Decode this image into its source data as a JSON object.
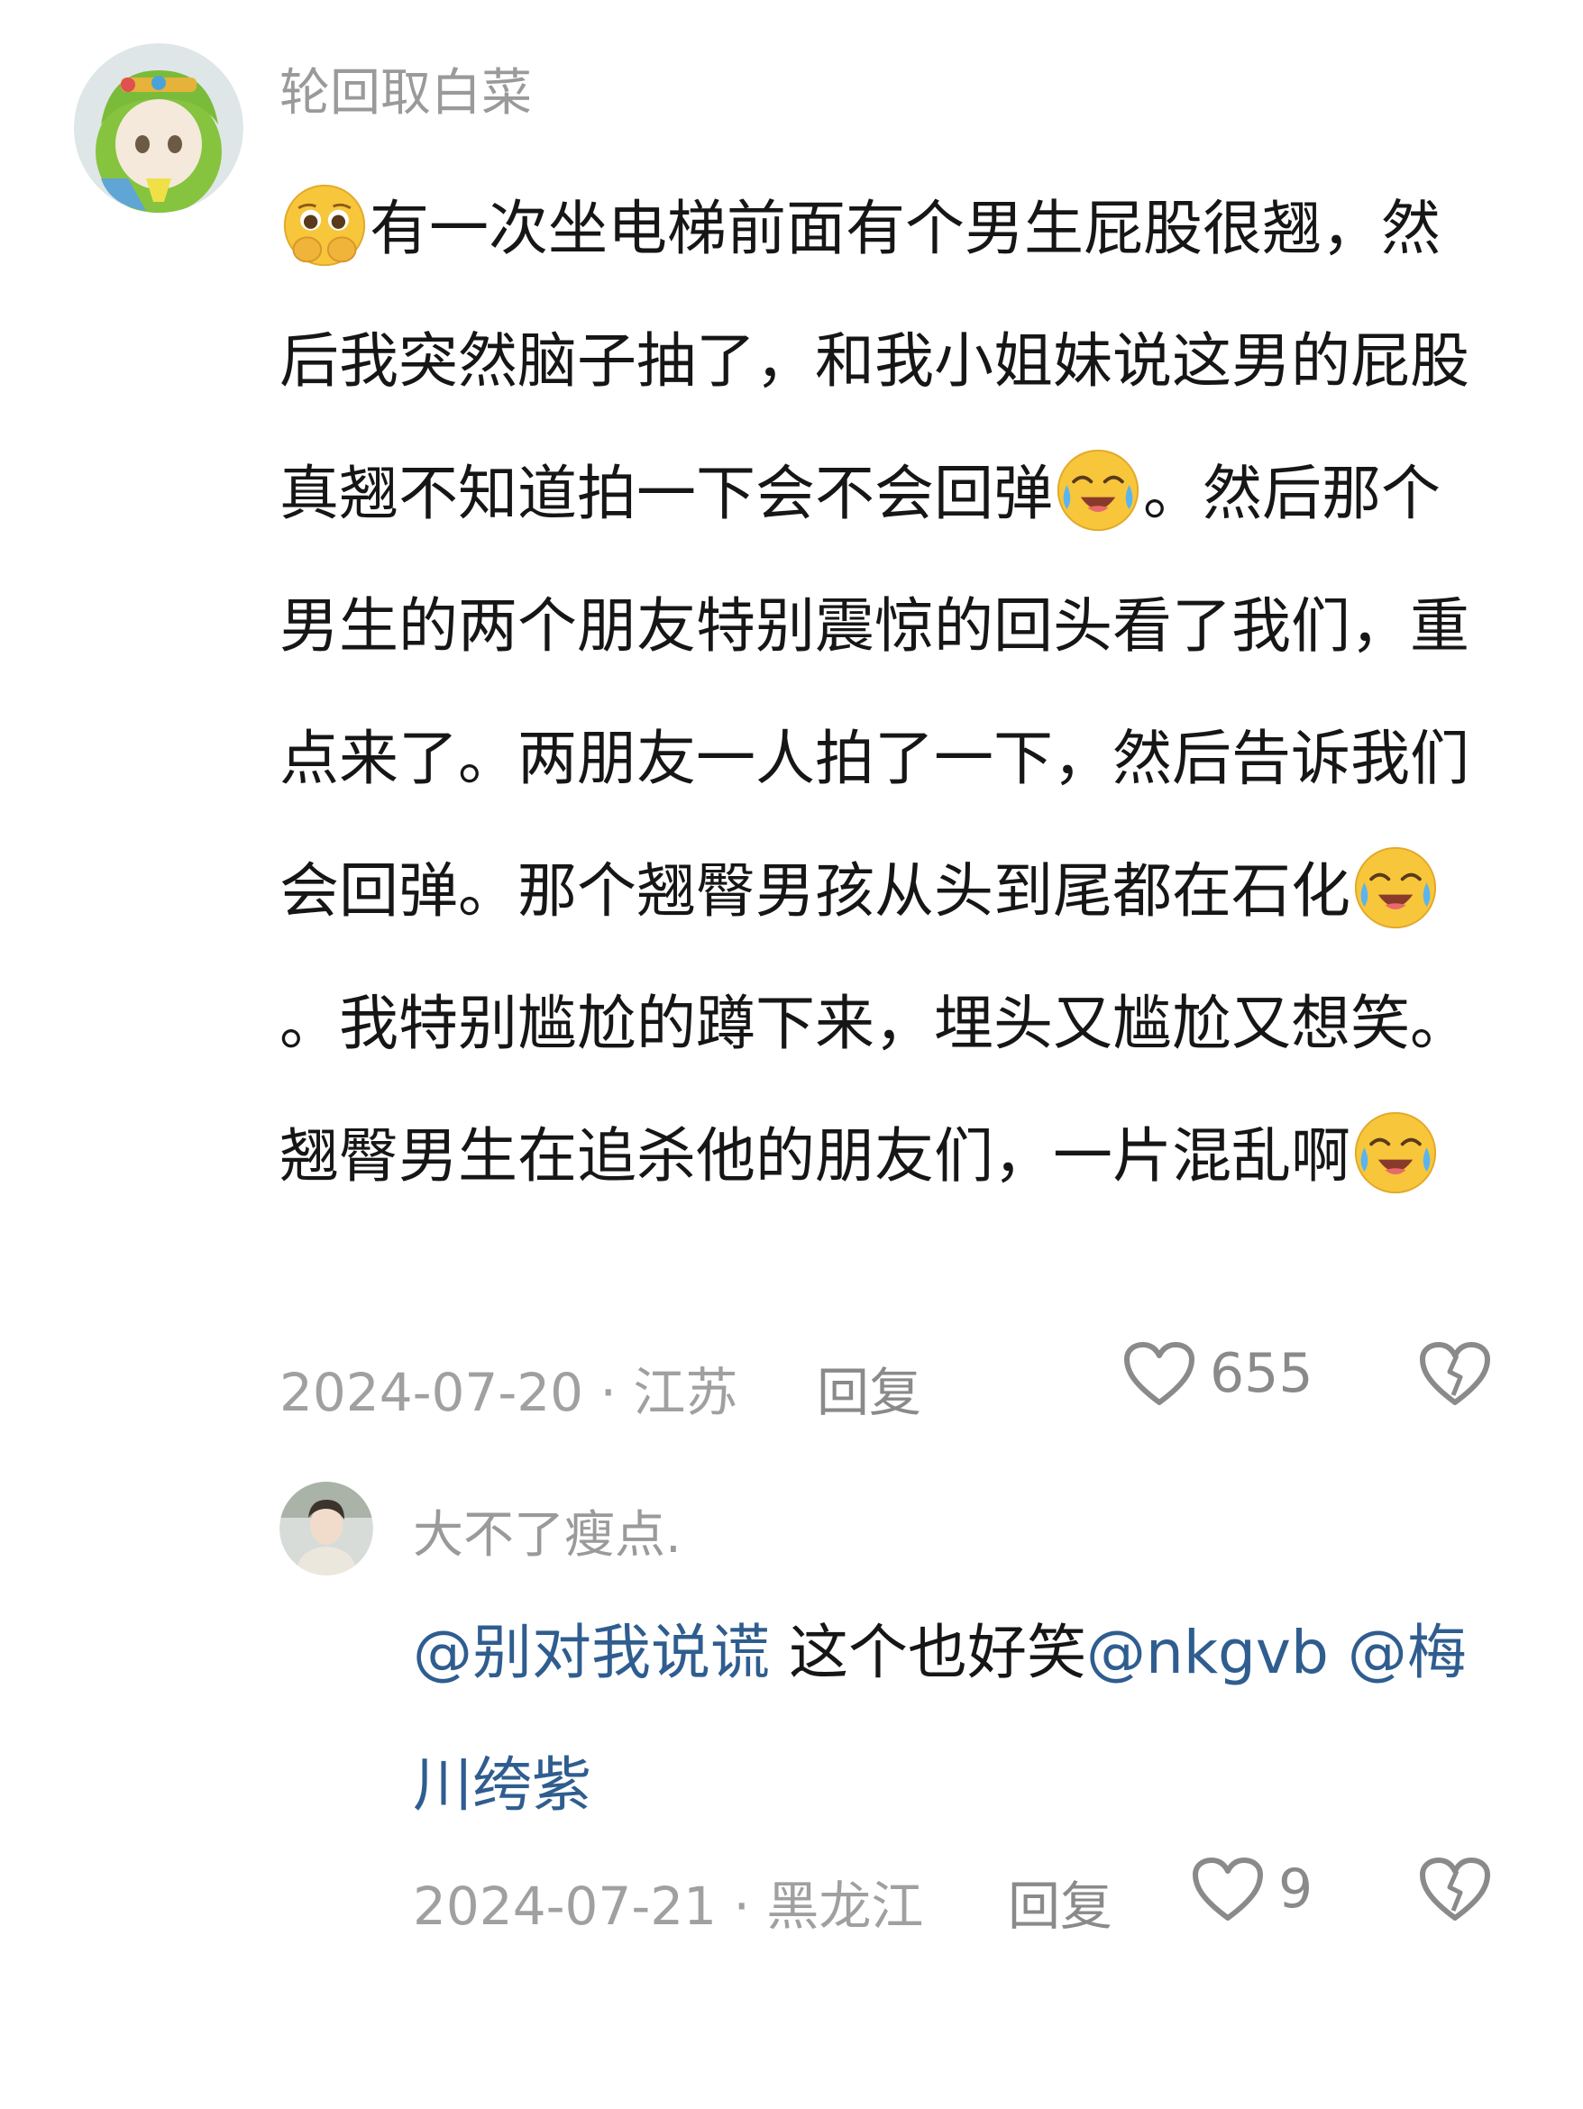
{
  "comment": {
    "username": "轮回取白菜",
    "segments": [
      {
        "type": "emoji",
        "name": "pleading-face-icon"
      },
      {
        "type": "text",
        "value": "有一次坐电梯前面有个男生屁股很翘，然后我突然脑子抽了，和我小姐妹说这男的屁股真翘不知道拍一下会不会回弹"
      },
      {
        "type": "emoji",
        "name": "crying-laughing-face-icon"
      },
      {
        "type": "text",
        "value": "。然后那个男生的两个朋友特别震惊的回头看了我们，重点来了。两朋友一人拍了一下，然后告诉我们会回弹。那个翘臀男孩从头到尾都在石化"
      },
      {
        "type": "emoji",
        "name": "crying-laughing-face-icon"
      },
      {
        "type": "text",
        "value": "。我特别尴尬的蹲下来，埋头又尴尬又想笑。翘臀男生在追杀他的朋友们，一片混乱啊"
      },
      {
        "type": "emoji",
        "name": "crying-laughing-face-icon"
      }
    ],
    "date_location": "2024-07-20 · 江苏",
    "reply_label": "回复",
    "like_count": "655"
  },
  "reply": {
    "username": "大不了瘦点.",
    "segments": [
      {
        "type": "mention",
        "value": "@别对我说谎"
      },
      {
        "type": "text",
        "value": " 这个也好笑"
      },
      {
        "type": "mention",
        "value": "@nkgvb"
      },
      {
        "type": "text",
        "value": " "
      },
      {
        "type": "mention",
        "value": "@梅川绔紫"
      }
    ],
    "date_location": "2024-07-21 · 黑龙江",
    "reply_label": "回复",
    "like_count": "9"
  },
  "colors": {
    "mention": "#2f5d8f",
    "meta_gray": "#a0a0a0",
    "username_gray": "#9a9a9a",
    "emoji_yellow": "#f7c63b"
  }
}
